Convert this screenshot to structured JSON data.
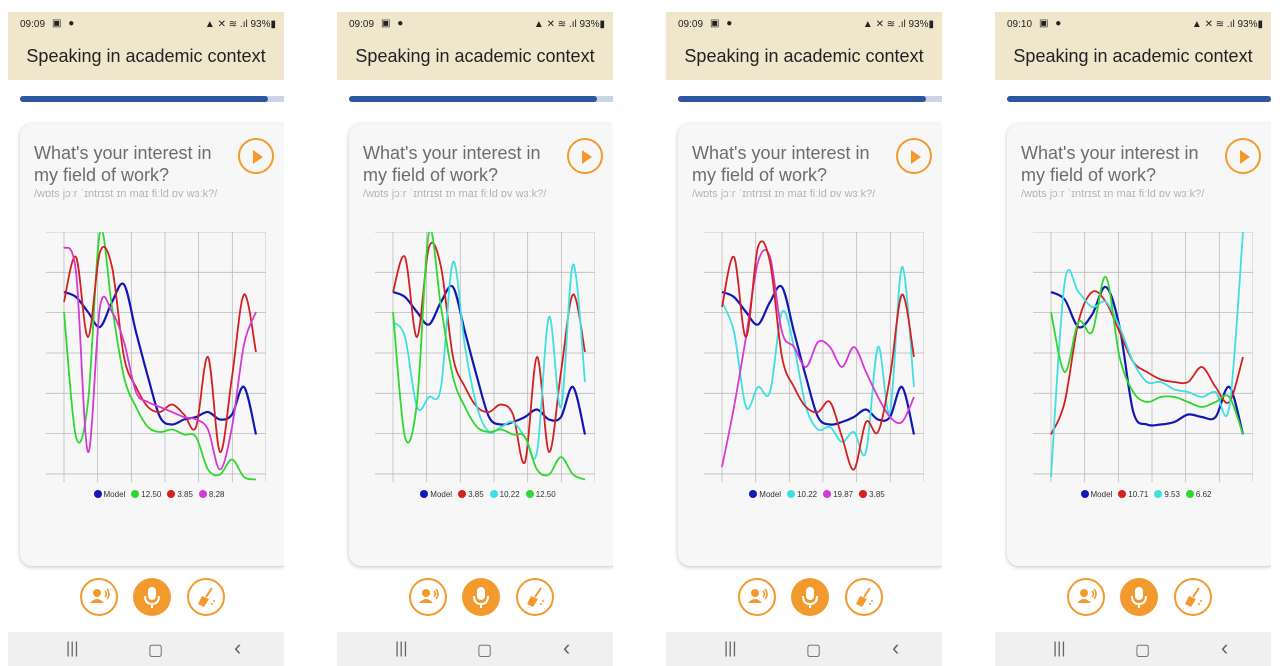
{
  "phones": [
    {
      "status": {
        "time": "09:09",
        "right": "93%"
      },
      "title": "Speaking in academic context",
      "progress": 0.91,
      "question": "What's your interest in my field of work?",
      "phonetic": "/wɒts jɔːr ˈɪntrɪst ɪn maɪ fiːld ɒv wɜːk?/",
      "legend": [
        {
          "label": "Model",
          "color": "#1018b8"
        },
        {
          "label": "12.50",
          "color": "#2fd82f"
        },
        {
          "label": "3.85",
          "color": "#d42020"
        },
        {
          "label": "8.28",
          "color": "#d43ad4"
        }
      ]
    },
    {
      "status": {
        "time": "09:09",
        "right": "93%"
      },
      "title": "Speaking in academic context",
      "progress": 0.91,
      "question": "What's your interest in my field of work?",
      "phonetic": "/wɒts jɔːr ˈɪntrɪst ɪn maɪ fiːld ɒv wɜːk?/",
      "legend": [
        {
          "label": "Model",
          "color": "#1018b8"
        },
        {
          "label": "3.85",
          "color": "#d42020"
        },
        {
          "label": "10.22",
          "color": "#3ee0e0"
        },
        {
          "label": "12.50",
          "color": "#2fd82f"
        }
      ]
    },
    {
      "status": {
        "time": "09:09",
        "right": "93%"
      },
      "title": "Speaking in academic context",
      "progress": 0.91,
      "question": "What's your interest in my field of work?",
      "phonetic": "/wɒts jɔːr ˈɪntrɪst ɪn maɪ fiːld ɒv wɜːk?/",
      "legend": [
        {
          "label": "Model",
          "color": "#1018b8"
        },
        {
          "label": "10.22",
          "color": "#3ee0e0"
        },
        {
          "label": "19.87",
          "color": "#d43ad4"
        },
        {
          "label": "3.85",
          "color": "#d42020"
        }
      ]
    },
    {
      "status": {
        "time": "09:10",
        "right": "93%"
      },
      "title": "Speaking in academic context",
      "progress": 0.97,
      "question": "What's your interest in my field of work?",
      "phonetic": "/wɒts jɔːr ˈɪntrɪst ɪn maɪ fiːld ɒv wɜːk?/",
      "legend": [
        {
          "label": "Model",
          "color": "#1018b8"
        },
        {
          "label": "10.71",
          "color": "#d42020"
        },
        {
          "label": "9.53",
          "color": "#3ee0e0"
        },
        {
          "label": "6.62",
          "color": "#2fd82f"
        }
      ]
    }
  ],
  "chart_data": [
    {
      "type": "line",
      "ylim": [
        0,
        10
      ],
      "series": [
        {
          "name": "Model",
          "color": "#1018b8",
          "values": [
            7.6,
            7.4,
            6.8,
            6.2,
            7.2,
            7.9,
            6.0,
            4.2,
            2.6,
            2.3,
            2.5,
            2.6,
            2.8,
            2.5,
            2.7,
            3.8,
            1.9
          ]
        },
        {
          "name": "12.50",
          "color": "#2fd82f",
          "values": [
            6.8,
            1.8,
            3.2,
            10.0,
            7.0,
            4.2,
            3.0,
            2.2,
            2.0,
            2.1,
            1.9,
            1.8,
            0.5,
            0.3,
            0.9,
            0.2,
            0.1
          ]
        },
        {
          "name": "3.85",
          "color": "#d42020",
          "values": [
            7.2,
            9.0,
            5.8,
            9.2,
            8.6,
            5.0,
            3.8,
            3.0,
            2.8,
            3.1,
            2.7,
            2.2,
            5.0,
            1.2,
            4.2,
            7.5,
            5.2
          ]
        },
        {
          "name": "8.28",
          "color": "#d43ad4",
          "values": [
            9.4,
            8.4,
            1.2,
            7.0,
            6.8,
            5.6,
            3.6,
            3.2,
            3.0,
            2.8,
            2.6,
            2.5,
            2.1,
            0.5,
            2.2,
            5.5,
            6.8
          ]
        }
      ]
    },
    {
      "type": "line",
      "ylim": [
        0,
        10
      ],
      "series": [
        {
          "name": "Model",
          "color": "#1018b8",
          "values": [
            7.6,
            7.4,
            6.8,
            6.3,
            7.2,
            7.8,
            6.0,
            4.2,
            2.6,
            2.3,
            2.4,
            2.6,
            2.9,
            2.5,
            2.6,
            3.8,
            1.9
          ]
        },
        {
          "name": "3.85",
          "color": "#d42020",
          "values": [
            7.6,
            9.0,
            5.8,
            9.4,
            8.6,
            5.0,
            3.8,
            3.0,
            2.8,
            3.1,
            2.7,
            0.8,
            5.0,
            1.2,
            4.4,
            7.5,
            5.2
          ]
        },
        {
          "name": "10.22",
          "color": "#3ee0e0",
          "values": [
            6.4,
            5.8,
            3.0,
            3.4,
            3.8,
            8.8,
            5.4,
            3.0,
            2.0,
            2.2,
            2.4,
            1.8,
            1.2,
            6.6,
            3.0,
            8.7,
            4.0
          ]
        },
        {
          "name": "12.50",
          "color": "#2fd82f",
          "values": [
            6.8,
            1.8,
            3.2,
            10.0,
            7.0,
            4.2,
            3.0,
            2.2,
            2.0,
            2.1,
            1.9,
            1.8,
            0.5,
            0.3,
            1.0,
            0.3,
            0.1
          ]
        }
      ]
    },
    {
      "type": "line",
      "ylim": [
        0,
        10
      ],
      "series": [
        {
          "name": "Model",
          "color": "#1018b8",
          "values": [
            7.6,
            7.4,
            6.8,
            6.3,
            7.2,
            7.8,
            6.0,
            4.2,
            2.6,
            2.3,
            2.4,
            2.6,
            2.9,
            2.5,
            2.6,
            3.8,
            1.9
          ]
        },
        {
          "name": "10.22",
          "color": "#3ee0e0",
          "values": [
            7.2,
            6.0,
            3.0,
            3.8,
            3.6,
            6.8,
            5.4,
            3.0,
            2.1,
            2.2,
            1.6,
            2.0,
            1.2,
            5.4,
            2.8,
            8.6,
            3.8
          ]
        },
        {
          "name": "19.87",
          "color": "#d43ad4",
          "values": [
            0.6,
            3.0,
            5.8,
            8.8,
            9.0,
            6.0,
            5.4,
            4.6,
            5.6,
            5.4,
            4.6,
            5.4,
            4.4,
            3.4,
            2.6,
            2.4,
            3.4
          ]
        },
        {
          "name": "3.85",
          "color": "#d42020",
          "values": [
            7.0,
            9.0,
            5.8,
            9.4,
            8.8,
            5.0,
            3.8,
            3.0,
            2.8,
            3.2,
            1.8,
            0.5,
            2.4,
            2.0,
            4.2,
            7.5,
            5.0
          ]
        }
      ]
    },
    {
      "type": "line",
      "ylim": [
        0,
        10
      ],
      "series": [
        {
          "name": "Model",
          "color": "#1018b8",
          "values": [
            7.6,
            7.3,
            6.2,
            6.7,
            7.8,
            6.2,
            2.8,
            2.3,
            2.3,
            2.4,
            2.7,
            2.6,
            2.6,
            3.8,
            1.9
          ]
        },
        {
          "name": "10.71",
          "color": "#d42020",
          "values": [
            1.9,
            3.2,
            6.4,
            7.6,
            7.2,
            6.0,
            4.8,
            4.4,
            4.1,
            4.0,
            4.0,
            4.6,
            3.8,
            3.2,
            5.0
          ]
        },
        {
          "name": "9.53",
          "color": "#3ee0e0",
          "values": [
            0.2,
            8.0,
            7.6,
            7.0,
            7.2,
            6.2,
            4.8,
            4.0,
            4.0,
            3.7,
            3.6,
            3.4,
            3.6,
            3.0,
            10.0
          ]
        },
        {
          "name": "6.62",
          "color": "#2fd82f",
          "values": [
            6.8,
            4.4,
            6.4,
            6.0,
            8.2,
            5.0,
            3.6,
            3.2,
            3.4,
            3.4,
            3.2,
            3.0,
            3.2,
            3.4,
            1.9
          ]
        }
      ]
    }
  ]
}
